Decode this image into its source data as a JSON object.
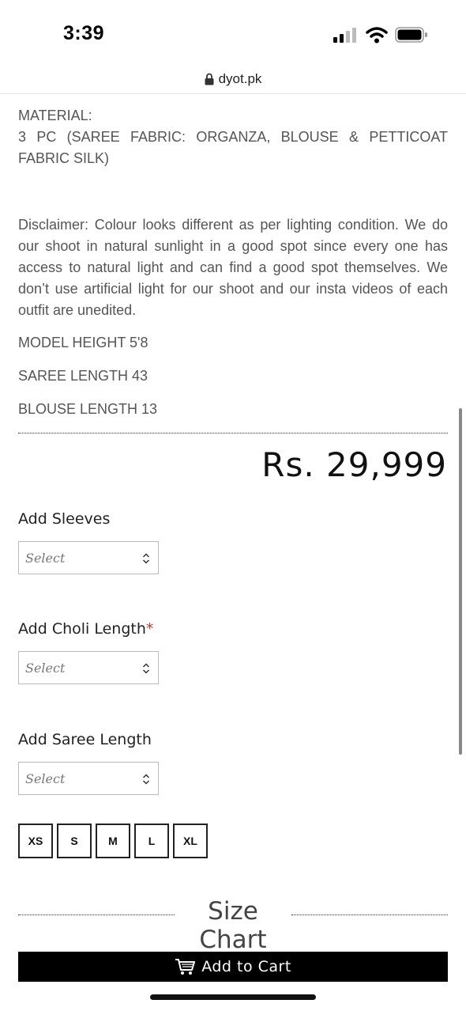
{
  "status_bar": {
    "time": "3:39"
  },
  "browser": {
    "url": "dyot.pk"
  },
  "product": {
    "material_heading": "MATERIAL:",
    "material_text": "3 PC (SAREE FABRIC: ORGANZA, BLOUSE & PETTICOAT FABRIC SILK)",
    "disclaimer": "Disclaimer: Colour looks different as per lighting condition. We do our shoot in natural sunlight in a good spot since every one has access to natural light and can find a good spot themselves. We don’t use artificial light for our shoot and our insta videos of each outfit are unedited.",
    "model_height": "MODEL HEIGHT 5'8",
    "saree_length": "SAREE LENGTH 43",
    "blouse_length": "BLOUSE LENGTH 13",
    "price": "Rs. 29,999"
  },
  "options": {
    "sleeves": {
      "label": "Add Sleeves",
      "selected": "Select"
    },
    "choli_length": {
      "label": "Add Choli Length",
      "required_mark": "*",
      "selected": "Select"
    },
    "saree_length": {
      "label": "Add Saree Length",
      "selected": "Select"
    }
  },
  "sizes": [
    "XS",
    "S",
    "M",
    "L",
    "XL"
  ],
  "size_chart_label": "Size Chart",
  "add_to_cart_label": "Add to Cart",
  "colors": {
    "button_bg": "#000000",
    "required": "#c0392b"
  },
  "icons": [
    "signal-icon",
    "wifi-icon",
    "battery-icon",
    "lock-icon",
    "chevron-updown-icon",
    "cart-icon"
  ]
}
